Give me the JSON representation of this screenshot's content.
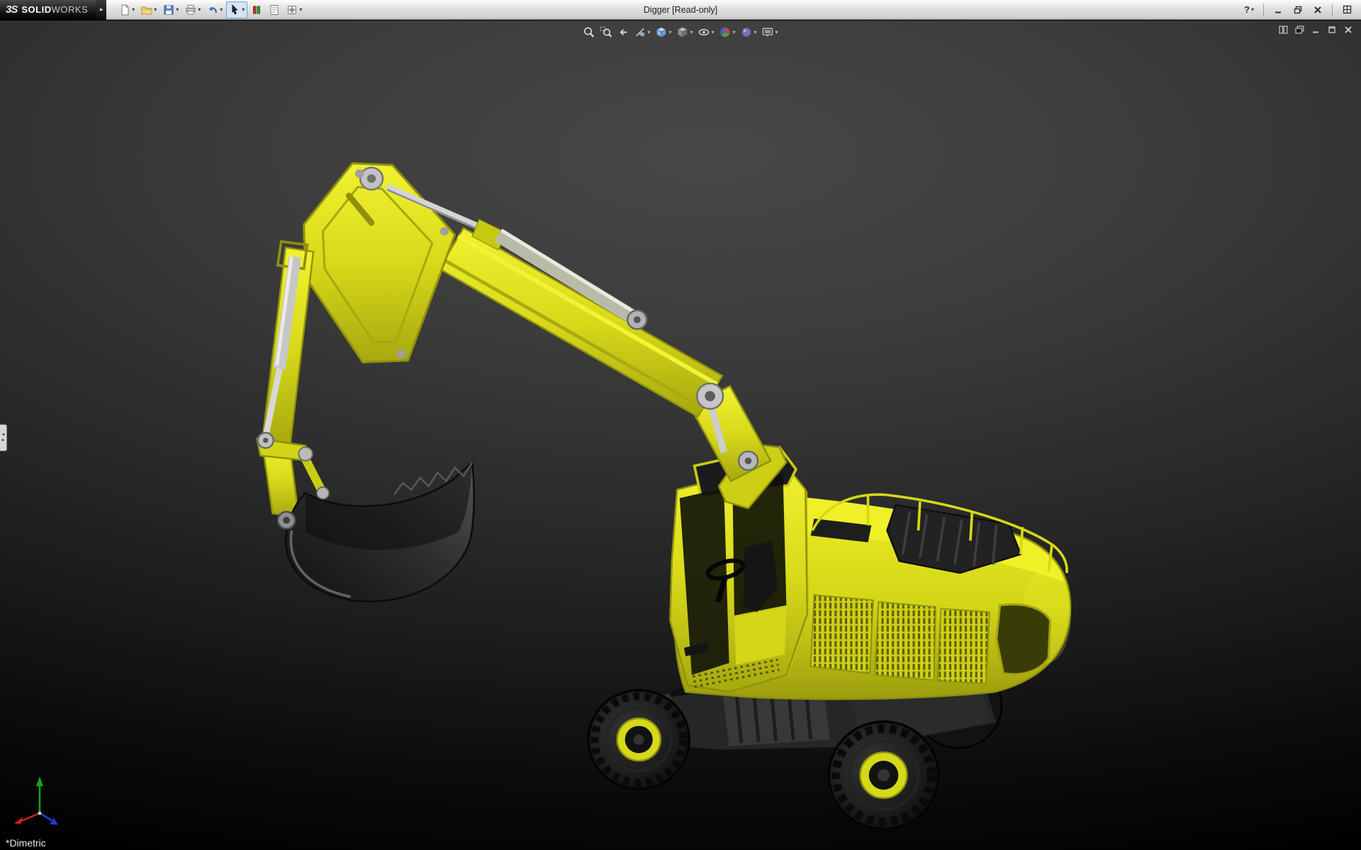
{
  "window": {
    "title": "Digger [Read-only]",
    "help_glyph": "?"
  },
  "brand": {
    "logo": "3S",
    "name_bold": "SOLID",
    "name_light": "WORKS"
  },
  "glyphs": {
    "caret": "▾",
    "brand_arrow": "▸",
    "arrow_left": "◂",
    "arrow_right": "▸"
  },
  "titlebar_toolbar": {
    "items": [
      "new-document",
      "open",
      "save",
      "print",
      "undo",
      "select",
      "rebuild",
      "file-properties",
      "options"
    ]
  },
  "heads_up_toolbar": {
    "items": [
      "zoom-to-fit",
      "zoom-to-area",
      "previous-view",
      "section-view",
      "view-orientation",
      "display-style",
      "hide-show-items",
      "edit-appearance",
      "apply-scene",
      "view-settings"
    ]
  },
  "document_controls": {
    "items": [
      "tile-windows",
      "cascade-windows",
      "minimize-document",
      "restore-document",
      "close-document"
    ]
  },
  "window_controls": {
    "items": [
      "help",
      "minimize",
      "restore",
      "close",
      "fullscreen"
    ]
  },
  "viewport": {
    "orientation_label": "*Dimetric"
  },
  "model": {
    "parts": [
      "boom",
      "stick",
      "bucket",
      "hydraulic-cylinders",
      "cab",
      "upper-body",
      "engine-cover",
      "railing",
      "chassis",
      "wheels"
    ],
    "colors": {
      "body_yellow": "#dcdd1c",
      "metal_gray": "#c6c6c6",
      "dark_gray": "#242424",
      "triad_x": "#cc2020",
      "triad_y": "#18a518",
      "triad_z": "#2038c8"
    }
  }
}
